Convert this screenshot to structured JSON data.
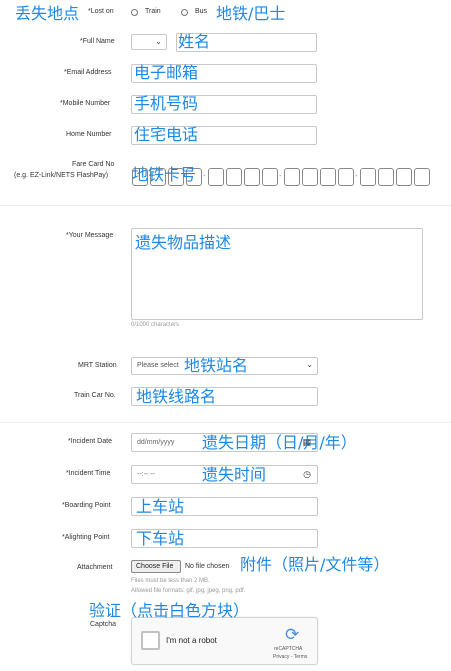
{
  "annotations": {
    "lost_place": "丢失地点",
    "transport": "地铁/巴士",
    "name": "姓名",
    "email": "电子邮箱",
    "mobile": "手机号码",
    "home": "住宅电话",
    "card": "地铁卡号",
    "message": "遗失物品描述",
    "station": "地铁站名",
    "train_car": "地铁线路名",
    "date": "遗失日期（日/月/年）",
    "time": "遗失时间",
    "boarding": "上车站",
    "alighting": "下车站",
    "attachment": "附件（照片/文件等）",
    "captcha": "验证（点击白色方块）"
  },
  "form": {
    "lost_on_label": "*Lost on",
    "train_option": "Train",
    "bus_option": "Bus",
    "full_name_label": "*Full Name",
    "email_label": "*Email Address",
    "mobile_label": "*Mobile Number",
    "home_label": "Home Number",
    "fare_card_label_1": "Fare Card No",
    "fare_card_label_2": "(e.g. EZ-Link/NETS FlashPay)",
    "message_label": "*Your Message",
    "char_count": "0/1000 characters",
    "mrt_label": "MRT Station",
    "mrt_placeholder": "Please select",
    "train_car_label": "Train Car No.",
    "incident_date_label": "*Incident Date",
    "date_placeholder": "dd/mm/yyyy",
    "incident_time_label": "*Incident Time",
    "time_placeholder": "--:-- --",
    "boarding_label": "*Boarding Point",
    "alighting_label": "*Alighting Point",
    "attachment_label": "Attachment",
    "choose_file": "Choose File",
    "no_file": "No file chosen",
    "file_note_1": "Files must be less than 2 MB.",
    "file_note_2": "Allowed file formats: gif, jpg, jpeg, png, pdf.",
    "captcha_label": "Captcha",
    "not_robot": "I'm not a robot",
    "recaptcha": "reCAPTCHA",
    "privacy_terms": "Privacy - Terms"
  }
}
